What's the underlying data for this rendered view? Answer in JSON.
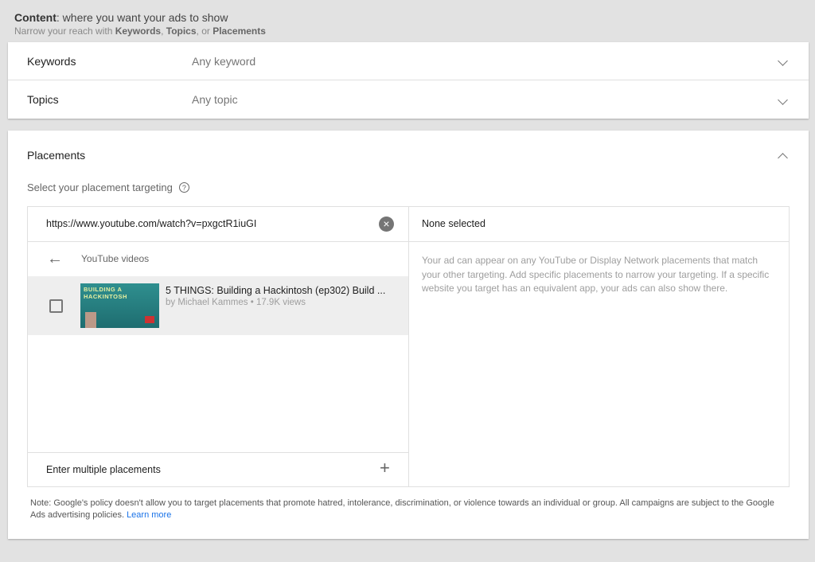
{
  "header": {
    "title_bold": "Content",
    "title_rest": ": where you want your ads to show",
    "subtitle_pre": "Narrow your reach with ",
    "kw": "Keywords",
    "sep1": ", ",
    "tp": "Topics",
    "sep2": ", or ",
    "pl": "Placements"
  },
  "keywords": {
    "label": "Keywords",
    "value": "Any keyword"
  },
  "topics": {
    "label": "Topics",
    "value": "Any topic"
  },
  "placements": {
    "title": "Placements",
    "subtitle": "Select your placement targeting",
    "search_value": "https://www.youtube.com/watch?v=pxgctR1iuGI",
    "back_label": "YouTube videos",
    "results": [
      {
        "title": "5 THINGS: Building a Hackintosh (ep302) Build ...",
        "meta": "by Michael Kammes • 17.9K views",
        "thumb_text": "BUILDING A HACKINTOSH"
      }
    ],
    "multiple_label": "Enter multiple placements",
    "selected_header": "None selected",
    "selected_info": "Your ad can appear on any YouTube or Display Network placements that match your other targeting. Add specific placements to narrow your targeting. If a specific website you target has an equivalent app, your ads can also show there."
  },
  "note": {
    "text": "Note: Google's policy doesn't allow you to target placements that promote hatred, intolerance, discrimination, or violence towards an individual or group. All campaigns are subject to the Google Ads advertising policies. ",
    "link": "Learn more"
  },
  "colors": {
    "link": "#1a73e8",
    "background": "#e2e2e2"
  }
}
